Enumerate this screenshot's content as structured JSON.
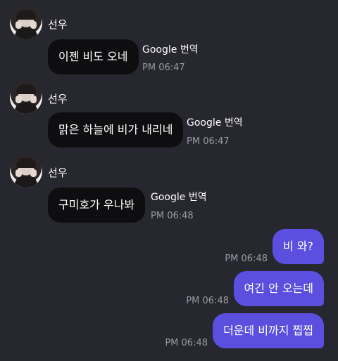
{
  "messages_in": [
    {
      "sender": "선우",
      "text": "이젠 비도 오네",
      "translate": "Google 번역",
      "time": "PM 06:47"
    },
    {
      "sender": "선우",
      "text": "맑은 하늘에 비가 내리네",
      "translate": "Google 번역",
      "time": "PM 06:47"
    },
    {
      "sender": "선우",
      "text": "구미호가 우나봐",
      "translate": "Google 번역",
      "time": "PM 06:48"
    }
  ],
  "messages_out": [
    {
      "text": "비 와?",
      "time": "PM 06:48"
    },
    {
      "text": "여긴 안 오는데",
      "time": "PM 06:48"
    },
    {
      "text": "더운데 비까지 찝찝",
      "time": "PM 06:48"
    }
  ]
}
